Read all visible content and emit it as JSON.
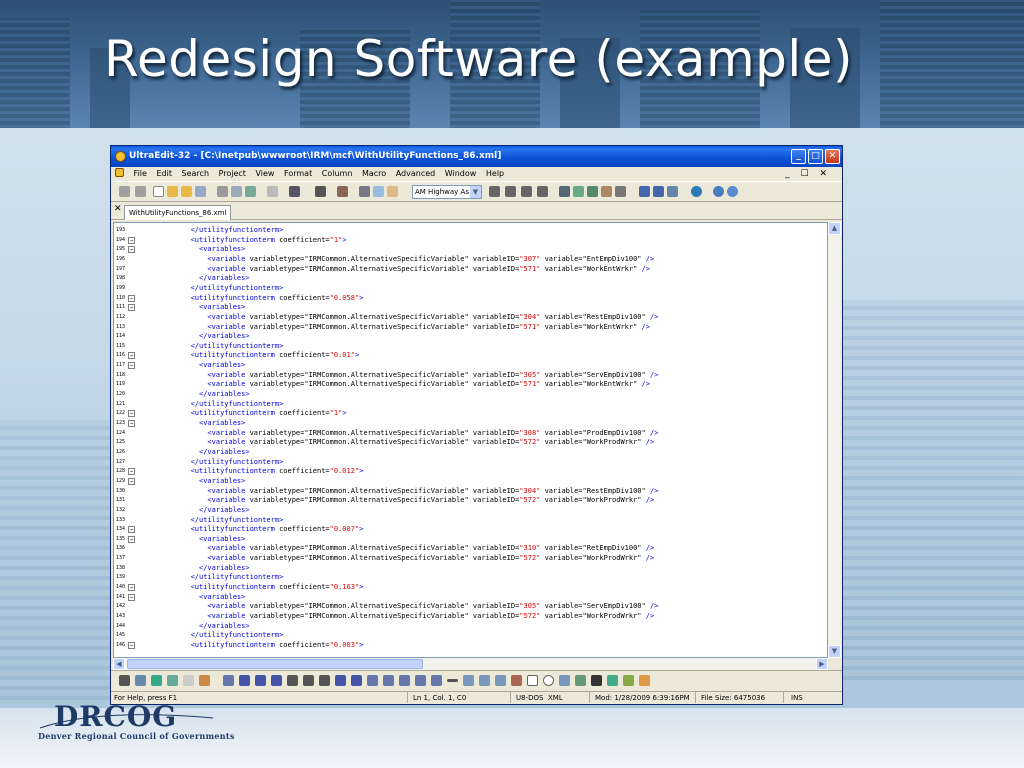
{
  "slide": {
    "title": "Redesign Software (example)",
    "logo_word": "DRCOG",
    "logo_sub": "Denver Regional Council of Governments"
  },
  "window": {
    "title": "UltraEdit-32 - [C:\\Inetpub\\wwwroot\\IRM\\mcf\\WithUtilityFunctions_86.xml]",
    "menu": [
      "File",
      "Edit",
      "Search",
      "Project",
      "View",
      "Format",
      "Column",
      "Macro",
      "Advanced",
      "Window",
      "Help"
    ],
    "mdi_controls": "_ ☐ ✕",
    "combo_value": "AM Highway As",
    "tab_label": "WithUtilityFunctions_86.xml",
    "tab_close": "✕"
  },
  "editor": {
    "lines": [
      {
        "n": "193",
        "fold": "",
        "c": [
          [
            "t",
            "            </utilityfunctionterm>"
          ]
        ]
      },
      {
        "n": "194",
        "fold": "-",
        "c": [
          [
            "t",
            "            <utilityfunctionterm"
          ],
          [
            "p",
            " coefficient="
          ],
          [
            "v",
            "\"1\""
          ],
          [
            "t",
            ">"
          ]
        ]
      },
      {
        "n": "195",
        "fold": "-",
        "c": [
          [
            "t",
            "              <variables>"
          ]
        ]
      },
      {
        "n": "196",
        "fold": "",
        "c": [
          [
            "t",
            "                <variable"
          ],
          [
            "p",
            " variabletype=\"IRMCommon.AlternativeSpecificVariable\" variableID="
          ],
          [
            "v",
            "\"307\""
          ],
          [
            "p",
            " variable=\"EntEmpDiv100\" "
          ],
          [
            "t",
            "/>"
          ]
        ]
      },
      {
        "n": "197",
        "fold": "",
        "c": [
          [
            "t",
            "                <variable"
          ],
          [
            "p",
            " variabletype=\"IRMCommon.AlternativeSpecificVariable\" variableID="
          ],
          [
            "v",
            "\"571\""
          ],
          [
            "p",
            " variable=\"WorkEntWrkr\" "
          ],
          [
            "t",
            "/>"
          ]
        ]
      },
      {
        "n": "198",
        "fold": "",
        "c": [
          [
            "t",
            "              </variables>"
          ]
        ]
      },
      {
        "n": "199",
        "fold": "",
        "c": [
          [
            "t",
            "            </utilityfunctionterm>"
          ]
        ]
      },
      {
        "n": "110",
        "fold": "-",
        "c": [
          [
            "t",
            "            <utilityfunctionterm"
          ],
          [
            "p",
            " coefficient="
          ],
          [
            "v",
            "\"0.058\""
          ],
          [
            "t",
            ">"
          ]
        ]
      },
      {
        "n": "111",
        "fold": "-",
        "c": [
          [
            "t",
            "              <variables>"
          ]
        ]
      },
      {
        "n": "112",
        "fold": "",
        "c": [
          [
            "t",
            "                <variable"
          ],
          [
            "p",
            " variabletype=\"IRMCommon.AlternativeSpecificVariable\" variableID="
          ],
          [
            "v",
            "\"304\""
          ],
          [
            "p",
            " variable=\"RestEmpDiv100\" "
          ],
          [
            "t",
            "/>"
          ]
        ]
      },
      {
        "n": "113",
        "fold": "",
        "c": [
          [
            "t",
            "                <variable"
          ],
          [
            "p",
            " variabletype=\"IRMCommon.AlternativeSpecificVariable\" variableID="
          ],
          [
            "v",
            "\"571\""
          ],
          [
            "p",
            " variable=\"WorkEntWrkr\" "
          ],
          [
            "t",
            "/>"
          ]
        ]
      },
      {
        "n": "114",
        "fold": "",
        "c": [
          [
            "t",
            "              </variables>"
          ]
        ]
      },
      {
        "n": "115",
        "fold": "",
        "c": [
          [
            "t",
            "            </utilityfunctionterm>"
          ]
        ]
      },
      {
        "n": "116",
        "fold": "-",
        "c": [
          [
            "t",
            "            <utilityfunctionterm"
          ],
          [
            "p",
            " coefficient="
          ],
          [
            "v",
            "\"0.01\""
          ],
          [
            "t",
            ">"
          ]
        ]
      },
      {
        "n": "117",
        "fold": "-",
        "c": [
          [
            "t",
            "              <variables>"
          ]
        ]
      },
      {
        "n": "118",
        "fold": "",
        "c": [
          [
            "t",
            "                <variable"
          ],
          [
            "p",
            " variabletype=\"IRMCommon.AlternativeSpecificVariable\" variableID="
          ],
          [
            "v",
            "\"305\""
          ],
          [
            "p",
            " variable=\"ServEmpDiv100\" "
          ],
          [
            "t",
            "/>"
          ]
        ]
      },
      {
        "n": "119",
        "fold": "",
        "c": [
          [
            "t",
            "                <variable"
          ],
          [
            "p",
            " variabletype=\"IRMCommon.AlternativeSpecificVariable\" variableID="
          ],
          [
            "v",
            "\"571\""
          ],
          [
            "p",
            " variable=\"WorkEntWrkr\" "
          ],
          [
            "t",
            "/>"
          ]
        ]
      },
      {
        "n": "120",
        "fold": "",
        "c": [
          [
            "t",
            "              </variables>"
          ]
        ]
      },
      {
        "n": "121",
        "fold": "",
        "c": [
          [
            "t",
            "            </utilityfunctionterm>"
          ]
        ]
      },
      {
        "n": "122",
        "fold": "-",
        "c": [
          [
            "t",
            "            <utilityfunctionterm"
          ],
          [
            "p",
            " coefficient="
          ],
          [
            "v",
            "\"1\""
          ],
          [
            "t",
            ">"
          ]
        ]
      },
      {
        "n": "123",
        "fold": "-",
        "c": [
          [
            "t",
            "              <variables>"
          ]
        ]
      },
      {
        "n": "124",
        "fold": "",
        "c": [
          [
            "t",
            "                <variable"
          ],
          [
            "p",
            " variabletype=\"IRMCommon.AlternativeSpecificVariable\" variableID="
          ],
          [
            "v",
            "\"308\""
          ],
          [
            "p",
            " variable=\"ProdEmpDiv100\" "
          ],
          [
            "t",
            "/>"
          ]
        ]
      },
      {
        "n": "125",
        "fold": "",
        "c": [
          [
            "t",
            "                <variable"
          ],
          [
            "p",
            " variabletype=\"IRMCommon.AlternativeSpecificVariable\" variableID="
          ],
          [
            "v",
            "\"572\""
          ],
          [
            "p",
            " variable=\"WorkProdWrkr\" "
          ],
          [
            "t",
            "/>"
          ]
        ]
      },
      {
        "n": "126",
        "fold": "",
        "c": [
          [
            "t",
            "              </variables>"
          ]
        ]
      },
      {
        "n": "127",
        "fold": "",
        "c": [
          [
            "t",
            "            </utilityfunctionterm>"
          ]
        ]
      },
      {
        "n": "128",
        "fold": "-",
        "c": [
          [
            "t",
            "            <utilityfunctionterm"
          ],
          [
            "p",
            " coefficient="
          ],
          [
            "v",
            "\"0.012\""
          ],
          [
            "t",
            ">"
          ]
        ]
      },
      {
        "n": "129",
        "fold": "-",
        "c": [
          [
            "t",
            "              <variables>"
          ]
        ]
      },
      {
        "n": "130",
        "fold": "",
        "c": [
          [
            "t",
            "                <variable"
          ],
          [
            "p",
            " variabletype=\"IRMCommon.AlternativeSpecificVariable\" variableID="
          ],
          [
            "v",
            "\"304\""
          ],
          [
            "p",
            " variable=\"RestEmpDiv100\" "
          ],
          [
            "t",
            "/>"
          ]
        ]
      },
      {
        "n": "131",
        "fold": "",
        "c": [
          [
            "t",
            "                <variable"
          ],
          [
            "p",
            " variabletype=\"IRMCommon.AlternativeSpecificVariable\" variableID="
          ],
          [
            "v",
            "\"572\""
          ],
          [
            "p",
            " variable=\"WorkProdWrkr\" "
          ],
          [
            "t",
            "/>"
          ]
        ]
      },
      {
        "n": "132",
        "fold": "",
        "c": [
          [
            "t",
            "              </variables>"
          ]
        ]
      },
      {
        "n": "133",
        "fold": "",
        "c": [
          [
            "t",
            "            </utilityfunctionterm>"
          ]
        ]
      },
      {
        "n": "134",
        "fold": "-",
        "c": [
          [
            "t",
            "            <utilityfunctionterm"
          ],
          [
            "p",
            " coefficient="
          ],
          [
            "v",
            "\"0.007\""
          ],
          [
            "t",
            ">"
          ]
        ]
      },
      {
        "n": "135",
        "fold": "-",
        "c": [
          [
            "t",
            "              <variables>"
          ]
        ]
      },
      {
        "n": "136",
        "fold": "",
        "c": [
          [
            "t",
            "                <variable"
          ],
          [
            "p",
            " variabletype=\"IRMCommon.AlternativeSpecificVariable\" variableID="
          ],
          [
            "v",
            "\"310\""
          ],
          [
            "p",
            " variable=\"RetEmpDiv100\" "
          ],
          [
            "t",
            "/>"
          ]
        ]
      },
      {
        "n": "137",
        "fold": "",
        "c": [
          [
            "t",
            "                <variable"
          ],
          [
            "p",
            " variabletype=\"IRMCommon.AlternativeSpecificVariable\" variableID="
          ],
          [
            "v",
            "\"572\""
          ],
          [
            "p",
            " variable=\"WorkProdWrkr\" "
          ],
          [
            "t",
            "/>"
          ]
        ]
      },
      {
        "n": "138",
        "fold": "",
        "c": [
          [
            "t",
            "              </variables>"
          ]
        ]
      },
      {
        "n": "139",
        "fold": "",
        "c": [
          [
            "t",
            "            </utilityfunctionterm>"
          ]
        ]
      },
      {
        "n": "140",
        "fold": "-",
        "c": [
          [
            "t",
            "            <utilityfunctionterm"
          ],
          [
            "p",
            " coefficient="
          ],
          [
            "v",
            "\"0.163\""
          ],
          [
            "t",
            ">"
          ]
        ]
      },
      {
        "n": "141",
        "fold": "-",
        "c": [
          [
            "t",
            "              <variables>"
          ]
        ]
      },
      {
        "n": "142",
        "fold": "",
        "c": [
          [
            "t",
            "                <variable"
          ],
          [
            "p",
            " variabletype=\"IRMCommon.AlternativeSpecificVariable\" variableID="
          ],
          [
            "v",
            "\"305\""
          ],
          [
            "p",
            " variable=\"ServEmpDiv100\" "
          ],
          [
            "t",
            "/>"
          ]
        ]
      },
      {
        "n": "143",
        "fold": "",
        "c": [
          [
            "t",
            "                <variable"
          ],
          [
            "p",
            " variabletype=\"IRMCommon.AlternativeSpecificVariable\" variableID="
          ],
          [
            "v",
            "\"572\""
          ],
          [
            "p",
            " variable=\"WorkProdWrkr\" "
          ],
          [
            "t",
            "/>"
          ]
        ]
      },
      {
        "n": "144",
        "fold": "",
        "c": [
          [
            "t",
            "              </variables>"
          ]
        ]
      },
      {
        "n": "145",
        "fold": "",
        "c": [
          [
            "t",
            "            </utilityfunctionterm>"
          ]
        ]
      },
      {
        "n": "146",
        "fold": "-",
        "c": [
          [
            "t",
            "            <utilityfunctionterm"
          ],
          [
            "p",
            " coefficient="
          ],
          [
            "v",
            "\"0.003\""
          ],
          [
            "t",
            ">"
          ]
        ]
      }
    ]
  },
  "status": {
    "help": "For Help, press F1",
    "position": "Ln 1, Col. 1, C0",
    "encoding": "U8-DOS",
    "syntax": "XML",
    "modified": "Mod: 1/28/2009 6:39:16PM",
    "file_size": "File Size: 6475036",
    "mode": "INS"
  },
  "colors": {
    "title_bar": "#0a4fd4",
    "tag": "#0000e0",
    "value": "#e00000",
    "slide_title": "#ffffff",
    "logo": "#1f3a66"
  }
}
